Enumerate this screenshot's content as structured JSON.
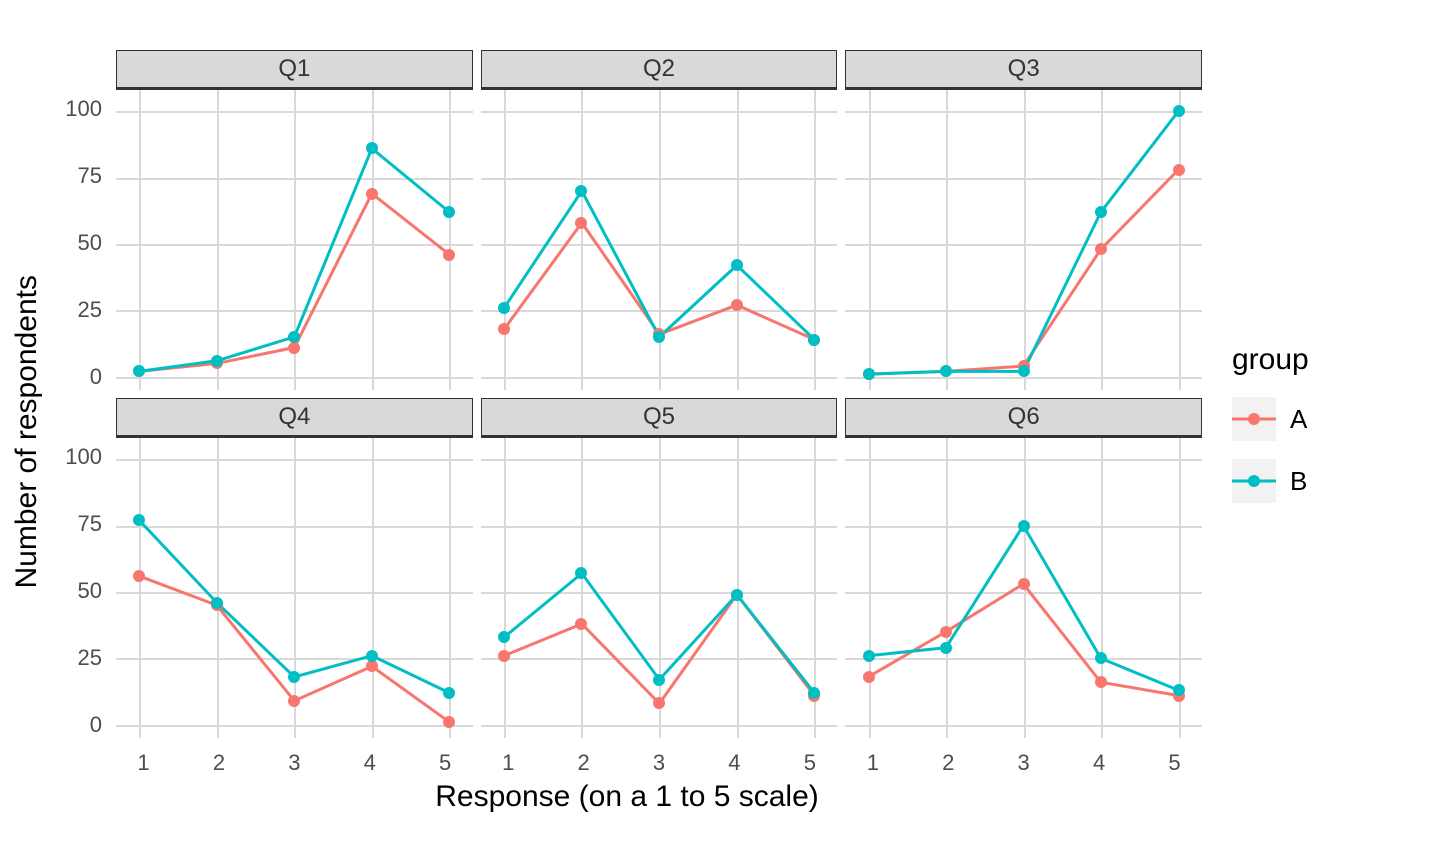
{
  "chart_data": {
    "type": "line",
    "xlabel": "Response (on a 1 to 5 scale)",
    "ylabel": "Number of respondents",
    "facets": [
      "Q1",
      "Q2",
      "Q3",
      "Q4",
      "Q5",
      "Q6"
    ],
    "x": [
      1,
      2,
      3,
      4,
      5
    ],
    "x_ticks": [
      1,
      2,
      3,
      4,
      5
    ],
    "y_ticks": [
      0,
      25,
      50,
      75,
      100
    ],
    "ylim": [
      -5,
      108
    ],
    "xlim": [
      0.7,
      5.3
    ],
    "series": [
      {
        "name": "A",
        "color": "#F8766D",
        "data": {
          "Q1": [
            2,
            5,
            11,
            69,
            46
          ],
          "Q2": [
            18,
            58,
            16,
            27,
            14
          ],
          "Q3": [
            1,
            2,
            4,
            48,
            78
          ],
          "Q4": [
            56,
            45,
            9,
            22,
            1
          ],
          "Q5": [
            26,
            38,
            8,
            49,
            11
          ],
          "Q6": [
            18,
            35,
            53,
            16,
            11
          ]
        }
      },
      {
        "name": "B",
        "color": "#00BFC4",
        "data": {
          "Q1": [
            2,
            6,
            15,
            86,
            62
          ],
          "Q2": [
            26,
            70,
            15,
            42,
            14
          ],
          "Q3": [
            1,
            2,
            2,
            62,
            100
          ],
          "Q4": [
            77,
            46,
            18,
            26,
            12
          ],
          "Q5": [
            33,
            57,
            17,
            49,
            12
          ],
          "Q6": [
            26,
            29,
            75,
            25,
            13
          ]
        }
      }
    ],
    "legend_title": "group"
  }
}
